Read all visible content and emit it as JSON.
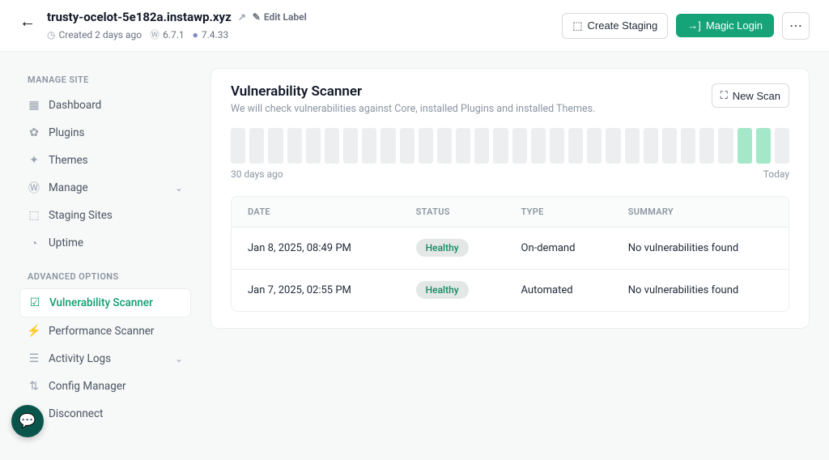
{
  "header": {
    "site_title": "trusty-ocelot-5e182a.instawp.xyz",
    "edit_label": "Edit Label",
    "created": "Created 2 days ago",
    "wp_version": "6.7.1",
    "php_version": "7.4.33",
    "create_staging": "Create Staging",
    "magic_login": "Magic Login"
  },
  "sidebar": {
    "heading_manage": "MANAGE SITE",
    "heading_advanced": "ADVANCED OPTIONS",
    "items_manage": [
      {
        "label": "Dashboard",
        "icon": "▦"
      },
      {
        "label": "Plugins",
        "icon": "✿"
      },
      {
        "label": "Themes",
        "icon": "✦"
      },
      {
        "label": "Manage",
        "icon": "Ⓦ",
        "expand": true
      },
      {
        "label": "Staging Sites",
        "icon": "⬚"
      },
      {
        "label": "Uptime",
        "icon": "◔"
      }
    ],
    "items_advanced": [
      {
        "label": "Vulnerability Scanner",
        "icon": "☑",
        "active": true
      },
      {
        "label": "Performance Scanner",
        "icon": "⚡"
      },
      {
        "label": "Activity Logs",
        "icon": "☰",
        "expand": true
      },
      {
        "label": "Config Manager",
        "icon": "⇅"
      },
      {
        "label": "Disconnect",
        "icon": "⤫"
      }
    ]
  },
  "scanner": {
    "title": "Vulnerability Scanner",
    "subtitle": "We will check vulnerabilities against Core, installed Plugins and installed Themes.",
    "new_scan": "New Scan",
    "range_left": "30 days ago",
    "range_right": "Today",
    "columns": {
      "date": "DATE",
      "status": "STATUS",
      "type": "TYPE",
      "summary": "SUMMARY"
    },
    "rows": [
      {
        "date": "Jan 8, 2025, 08:49 PM",
        "status": "Healthy",
        "type": "On-demand",
        "summary": "No vulnerabilities found"
      },
      {
        "date": "Jan 7, 2025, 02:55 PM",
        "status": "Healthy",
        "type": "Automated",
        "summary": "No vulnerabilities found"
      }
    ]
  },
  "chart_data": {
    "type": "bar",
    "description": "Scan activity over last 30 days",
    "categories_note": "30 daily bars; green bars indicate days with a scan",
    "bar_count": 30,
    "green_indices": [
      27,
      28
    ],
    "xlabel_left": "30 days ago",
    "xlabel_right": "Today"
  }
}
